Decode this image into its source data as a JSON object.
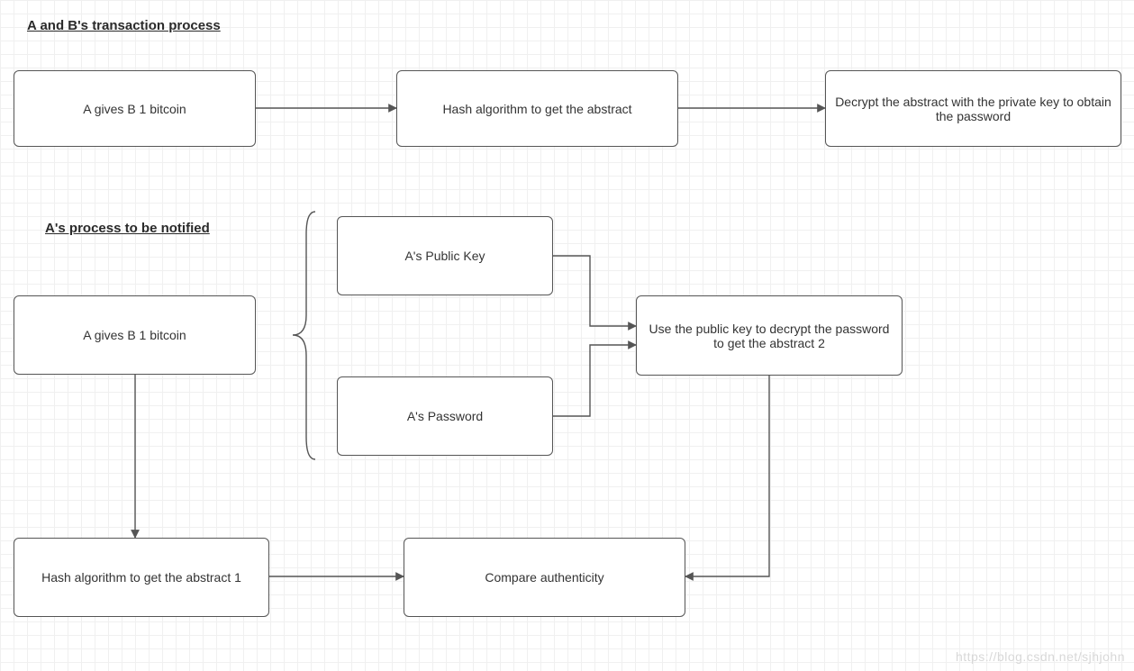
{
  "headings": {
    "top": "A and B's transaction process",
    "mid": "A's process to be notified"
  },
  "boxes": {
    "a1": "A gives B 1 bitcoin",
    "a2": "Hash algorithm to get the abstract",
    "a3": "Decrypt the abstract with the private key to obtain the password",
    "b1": "A gives B 1 bitcoin",
    "b2": "A's Public Key",
    "b3": "A's Password",
    "b4": "Use the public key to decrypt the password to get the abstract 2",
    "c1": "Hash algorithm to get the abstract 1",
    "c2": "Compare authenticity"
  },
  "watermark": "https://blog.csdn.net/sjhjohn"
}
